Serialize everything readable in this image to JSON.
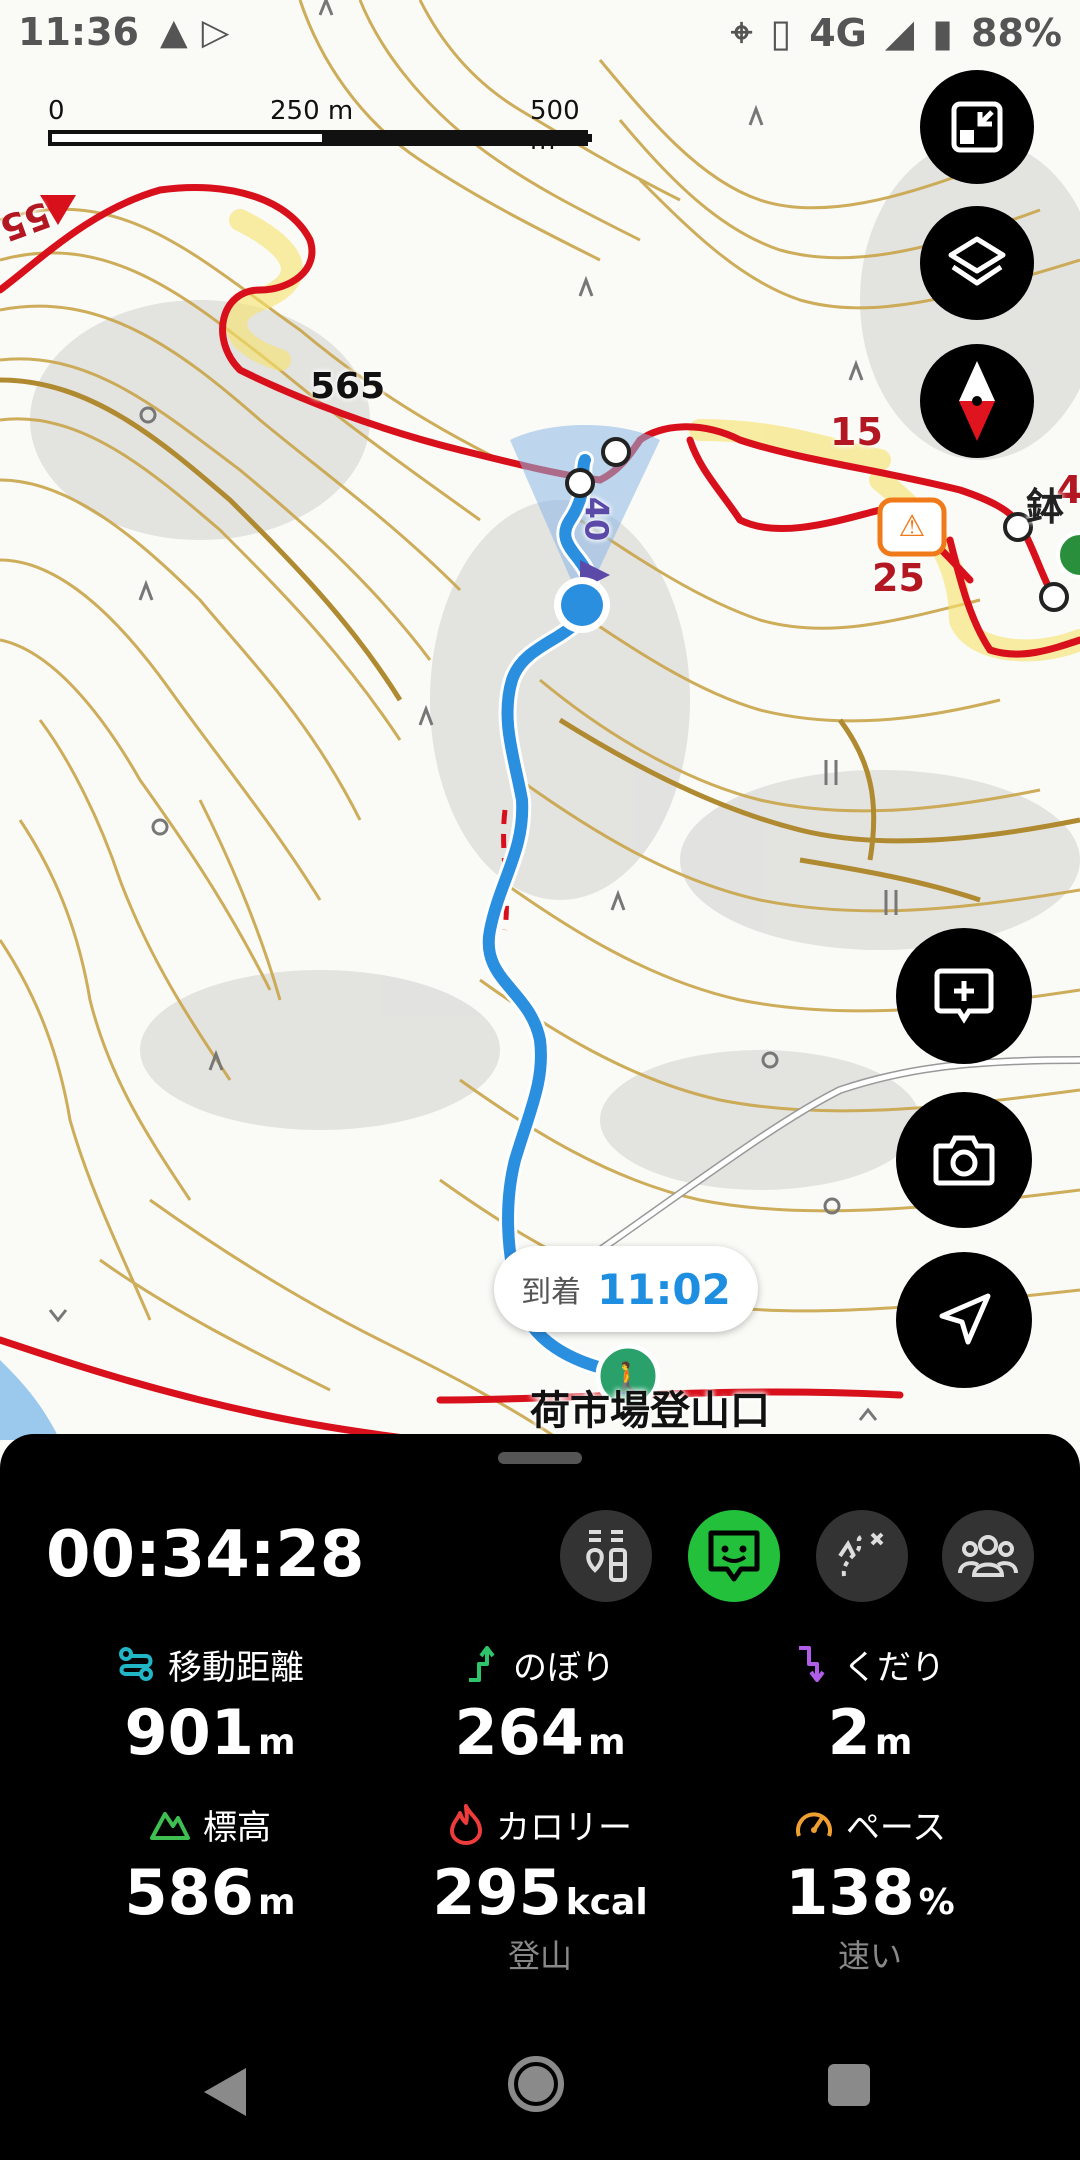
{
  "status_bar": {
    "time": "11:36",
    "network": "4G",
    "battery": "88%",
    "icons": [
      "warning-triangle-icon",
      "play-store-icon",
      "location-icon",
      "vibrate-icon",
      "signal-icon",
      "battery-icon"
    ]
  },
  "map": {
    "scale": {
      "zero": "0",
      "mid": "250 m",
      "end": "500 m"
    },
    "labels": {
      "peak": "565",
      "route_15": "15",
      "route_25": "25",
      "route_40": "40",
      "edge_left": "55",
      "edge_right": "4",
      "kanji_edge": "鉢"
    },
    "arrival": {
      "label": "到着",
      "time": "11:02"
    },
    "trailhead": "荷市場登山口",
    "colors": {
      "track": "#2b8fe0",
      "route": "#d8101c",
      "contour": "#c9a44a"
    },
    "buttons": [
      "fullscreen-exit-icon",
      "layers-icon",
      "compass-icon",
      "add-memo-icon",
      "camera-icon",
      "navigation-icon"
    ]
  },
  "panel": {
    "elapsed": "00:34:28",
    "mode_buttons": [
      "elevation-profile-icon",
      "status-face-icon",
      "route-plan-icon",
      "group-icon"
    ],
    "stats": [
      {
        "label": "移動距離",
        "value": "901",
        "unit": "m",
        "icon": "distance-icon",
        "icon_color": "#21b6c6"
      },
      {
        "label": "のぼり",
        "value": "264",
        "unit": "m",
        "icon": "ascent-icon",
        "icon_color": "#2fc46a"
      },
      {
        "label": "くだり",
        "value": "2",
        "unit": "m",
        "icon": "descent-icon",
        "icon_color": "#b05de8"
      },
      {
        "label": "標高",
        "value": "586",
        "unit": "m",
        "icon": "mountain-icon",
        "icon_color": "#3fbf52"
      },
      {
        "label": "カロリー",
        "value": "295",
        "unit": "kcal",
        "icon": "flame-icon",
        "icon_color": "#ee3b3b",
        "sub": "登山"
      },
      {
        "label": "ペース",
        "value": "138",
        "unit": "%",
        "icon": "speedometer-icon",
        "icon_color": "#f0a030",
        "sub": "速い"
      }
    ]
  },
  "nav_bar": [
    "back-icon",
    "home-icon",
    "recents-icon"
  ]
}
